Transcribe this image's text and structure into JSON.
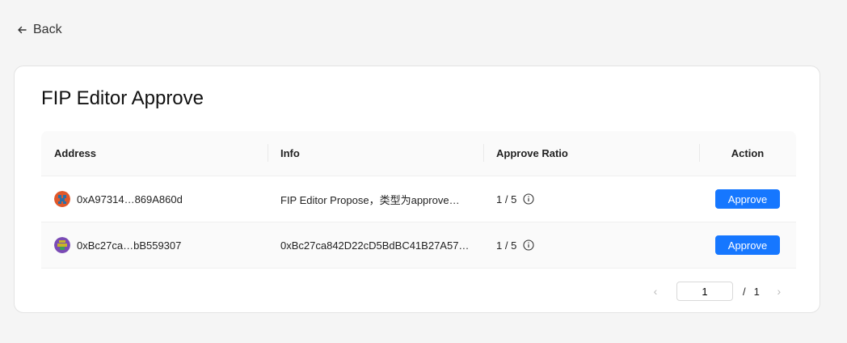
{
  "back_label": "Back",
  "title": "FIP Editor Approve",
  "columns": {
    "address": "Address",
    "info": "Info",
    "ratio": "Approve Ratio",
    "action": "Action"
  },
  "rows": [
    {
      "address_prefix": "0xA97314",
      "address_ellipsis": "…",
      "address_suffix": "869A860d",
      "info": "FIP Editor Propose，类型为approve…",
      "ratio": "1 / 5",
      "action_label": "Approve",
      "avatar_colors": [
        "#e0582a",
        "#2a6fa8"
      ]
    },
    {
      "address_prefix": "0xBc27ca",
      "address_ellipsis": "…",
      "address_suffix": "bB559307",
      "info": "0xBc27ca842D22cD5BdBC41B27A57…",
      "ratio": "1 / 5",
      "action_label": "Approve",
      "avatar_colors": [
        "#7a4bb5",
        "#c7b428"
      ]
    }
  ],
  "pagination": {
    "current": "1",
    "separator": "/",
    "total": "1"
  },
  "colors": {
    "accent": "#1677ff"
  }
}
